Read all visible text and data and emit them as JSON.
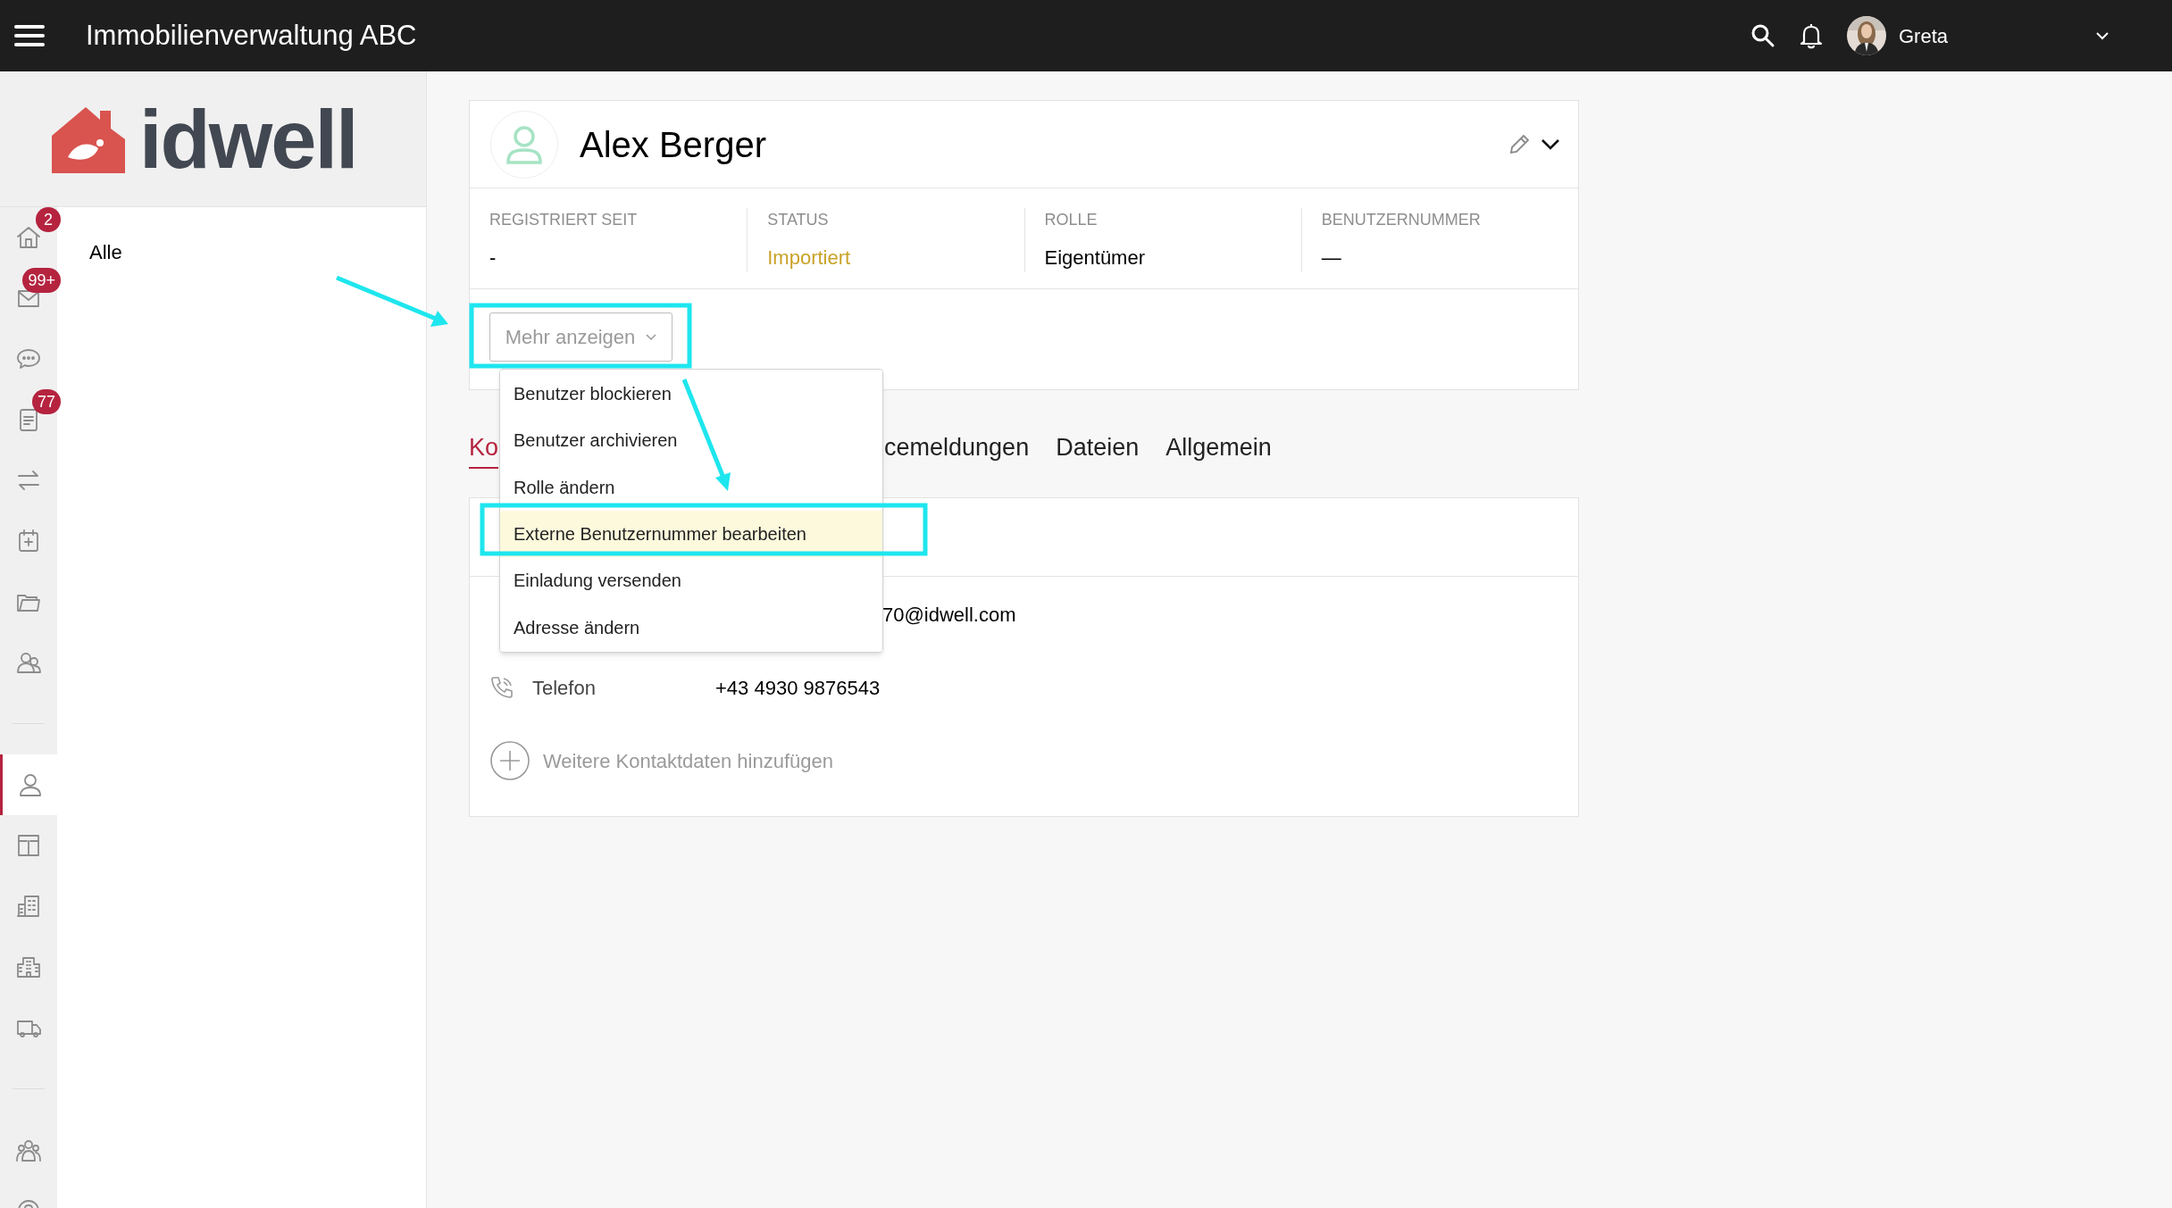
{
  "top_bar": {
    "title": "Immobilienverwaltung ABC",
    "user": "Greta"
  },
  "logo": {
    "wordmark": "idwell"
  },
  "rail": {
    "groups": [
      {
        "items": [
          {
            "badge": "2",
            "selected": false
          },
          {
            "badge": "99+",
            "selected": false
          },
          {
            "selected": false
          },
          {
            "badge": "77",
            "selected": false
          },
          {
            "selected": false
          },
          {
            "selected": false
          },
          {
            "selected": false
          },
          {
            "selected": false
          }
        ]
      },
      {
        "items": [
          {
            "selected": true
          },
          {
            "selected": false
          },
          {
            "selected": false
          },
          {
            "selected": false
          },
          {
            "selected": false
          }
        ]
      },
      {
        "items": [
          {
            "selected": false
          },
          {
            "selected": false
          }
        ]
      }
    ]
  },
  "panel": {
    "items": [
      "Alle"
    ]
  },
  "profile": {
    "name": "Alex Berger",
    "fields": [
      {
        "label": "REGISTRIERT SEIT",
        "value": "-"
      },
      {
        "label": "STATUS",
        "value": "Importiert",
        "color": "#c9a227"
      },
      {
        "label": "ROLLE",
        "value": "Eigentümer"
      },
      {
        "label": "BENUTZERNUMMER",
        "value": "—"
      }
    ],
    "more_button": "Mehr anzeigen",
    "menu": [
      {
        "label": "Benutzer blockieren",
        "selected": false
      },
      {
        "label": "Benutzer archivieren",
        "selected": false
      },
      {
        "label": "Rolle ändern",
        "selected": false
      },
      {
        "label": "Externe Benutzernummer bearbeiten",
        "selected": true
      },
      {
        "label": "Einladung versenden",
        "selected": false
      },
      {
        "label": "Adresse ändern",
        "selected": false
      }
    ]
  },
  "tabs": [
    {
      "label": "Ko",
      "selected": true
    },
    {
      "label": "cemeldungen",
      "selected": false
    },
    {
      "label": "Dateien",
      "selected": false
    },
    {
      "label": "Allgemein",
      "selected": false
    }
  ],
  "contact": {
    "email": "70@idwell.com",
    "phone_label": "Telefon",
    "phone": "+43 4930 9876543",
    "add": "Weitere Kontaktdaten hinzufügen"
  }
}
